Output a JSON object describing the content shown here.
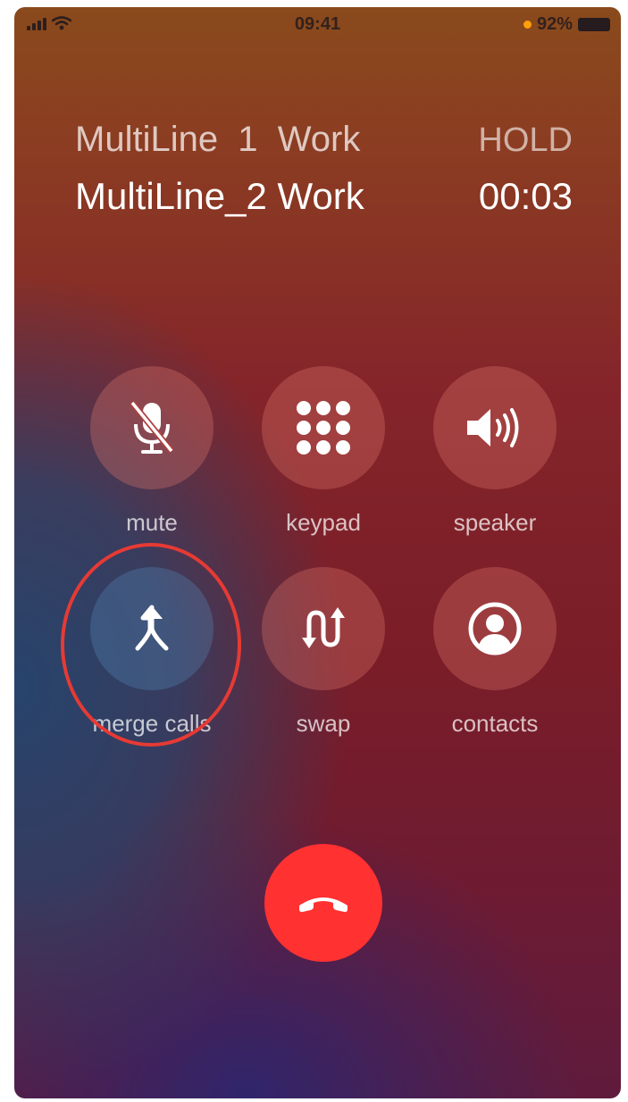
{
  "status": {
    "time": "09:41",
    "battery": "92%",
    "battery_dot_color": "#ff9f0a"
  },
  "calls": [
    {
      "name": "MultiLine  1  Work",
      "state": "HOLD"
    },
    {
      "name": "MultiLine_2 Work",
      "state": "00:03"
    }
  ],
  "buttons": {
    "mute": "mute",
    "keypad": "keypad",
    "speaker": "speaker",
    "merge": "merge calls",
    "swap": "swap",
    "contacts": "contacts"
  },
  "highlight_color": "#e63a34",
  "end_call_color": "#ff3131"
}
